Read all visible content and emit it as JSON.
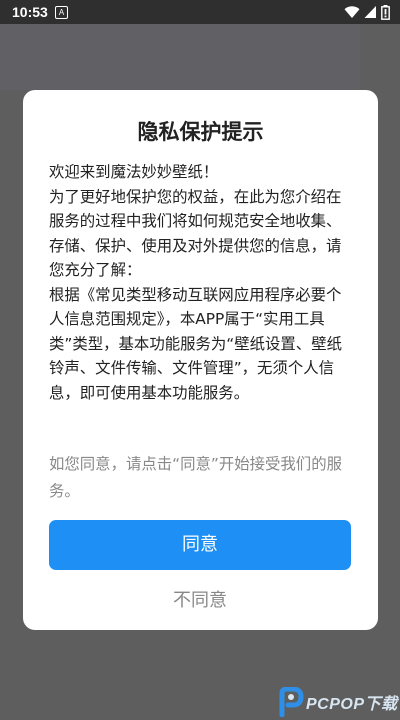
{
  "status_bar": {
    "time": "10:53",
    "notification_icon": "A"
  },
  "dialog": {
    "title": "隐私保护提示",
    "paragraphs": [
      "欢迎来到魔法妙妙壁纸！",
      "为了更好地保护您的权益，在此为您介绍在服务的过程中我们将如何规范安全地收集、存储、保护、使用及对外提供您的信息，请您充分了解：",
      "根据《常见类型移动互联网应用程序必要个人信息范围规定》，本APP属于“实用工具类”类型，基本功能服务为“壁纸设置、壁纸铃声、文件传输、文件管理”，无须个人信息，即可使用基本功能服务。"
    ],
    "hint": "如您同意，请点击“同意”开始接受我们的服务。",
    "agree_label": "同意",
    "disagree_label": "不同意"
  },
  "watermark": {
    "text": "PCPOP下载"
  },
  "colors": {
    "accent": "#1e90f5",
    "overlay": "#5e5e5e",
    "hint_text": "#888888"
  }
}
